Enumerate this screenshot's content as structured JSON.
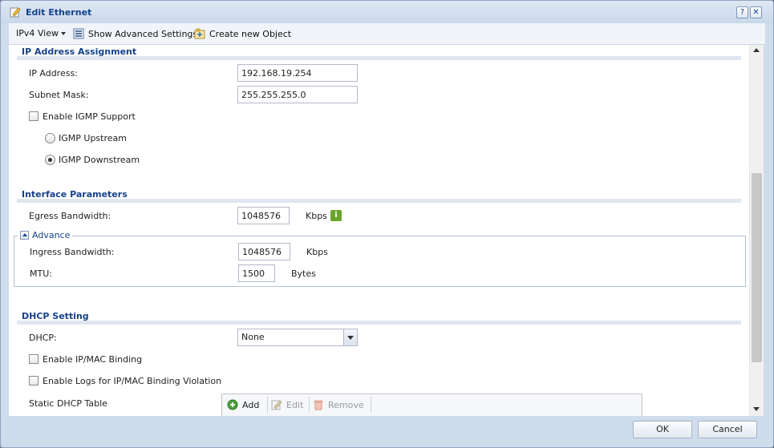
{
  "window": {
    "title": "Edit Ethernet",
    "help_label": "?",
    "close_label": "✕"
  },
  "toolbar": {
    "ipv4_view": "IPv4 View",
    "show_advanced": "Show Advanced Settings",
    "create_object": "Create new Object"
  },
  "ip_section": {
    "title": "IP Address Assignment",
    "ip_label": "IP Address:",
    "ip_value": "192.168.19.254",
    "subnet_label": "Subnet Mask:",
    "subnet_value": "255.255.255.0",
    "igmp_label": "Enable IGMP Support",
    "igmp_checked": false,
    "igmp_upstream": "IGMP Upstream",
    "igmp_downstream": "IGMP Downstream",
    "igmp_selected": "downstream"
  },
  "interface_section": {
    "title": "Interface Parameters",
    "egress_label": "Egress Bandwidth:",
    "egress_value": "1048576",
    "egress_unit": "Kbps",
    "info_icon": "i",
    "advance_label": "Advance",
    "ingress_label": "Ingress Bandwidth:",
    "ingress_value": "1048576",
    "ingress_unit": "Kbps",
    "mtu_label": "MTU:",
    "mtu_value": "1500",
    "mtu_unit": "Bytes"
  },
  "dhcp_section": {
    "title": "DHCP Setting",
    "dhcp_label": "DHCP:",
    "dhcp_value": "None",
    "ipmac_label": "Enable IP/MAC Binding",
    "logs_label": "Enable Logs for IP/MAC Binding Violation",
    "static_table_label": "Static DHCP Table",
    "add_label": "Add",
    "edit_label": "Edit",
    "remove_label": "Remove"
  },
  "footer": {
    "ok_label": "OK",
    "cancel_label": "Cancel"
  },
  "colors": {
    "title_blue": "#15428b",
    "frame": "#cfdcec",
    "info_green": "#6aa52a"
  }
}
